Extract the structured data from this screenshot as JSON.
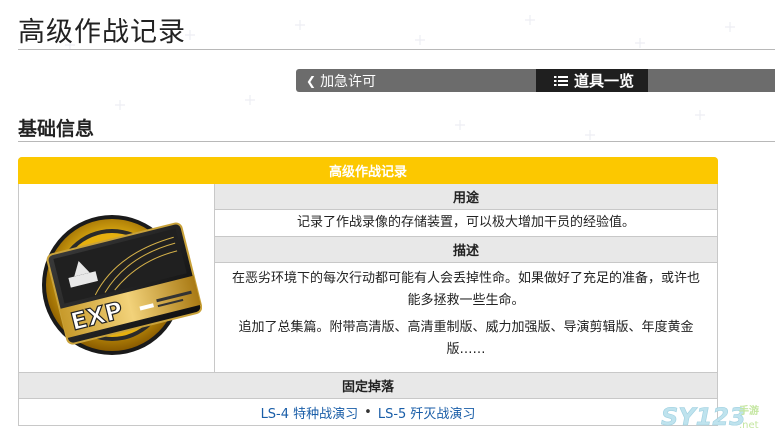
{
  "page": {
    "title": "高级作战记录"
  },
  "nav": {
    "prev_label": "加急许可",
    "list_label": "道具一览"
  },
  "section": {
    "title": "基础信息"
  },
  "item": {
    "name": "高级作战记录",
    "icon_text": "EXP",
    "usage_header": "用途",
    "usage_text": "记录了作战录像的存储装置，可以极大增加干员的经验值。",
    "desc_header": "描述",
    "desc_p1": "在恶劣环境下的每次行动都可能有人会丢掉性命。如果做好了充足的准备，或许也能多拯救一些生命。",
    "desc_p2": "追加了总集篇。附带高清版、高清重制版、威力加强版、导演剪辑版、年度黄金版……",
    "drop_header": "固定掉落",
    "drops": [
      "LS-4 特种战演习",
      "LS-5 歼灭战演习"
    ],
    "drop_separator": "•"
  },
  "watermark": {
    "brand": "SY123",
    "suffix": "手游",
    "domain": ".net"
  },
  "colors": {
    "header_yellow": "#fcc800",
    "link_blue": "#1a5ea8",
    "nav_gray": "#6c6c6c",
    "nav_active": "#1f1f1f"
  }
}
